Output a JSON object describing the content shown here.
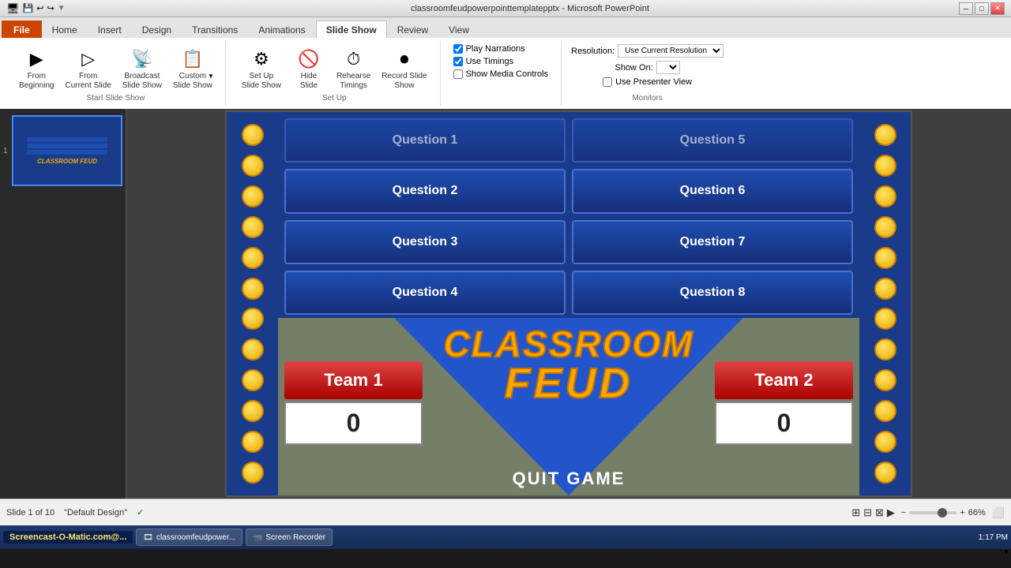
{
  "titlebar": {
    "title": "classroomfeudpowerpointtemplatepptx - Microsoft PowerPoint",
    "minimize": "─",
    "restore": "□",
    "close": "✕"
  },
  "ribbon": {
    "tabs": [
      "File",
      "Home",
      "Insert",
      "Design",
      "Transitions",
      "Animations",
      "Slide Show",
      "Review",
      "View"
    ],
    "active_tab": "Slide Show",
    "groups": {
      "start_slideshow": {
        "label": "Start Slide Show",
        "buttons": [
          {
            "label": "From Beginning",
            "icon": "▶"
          },
          {
            "label": "From Current Slide",
            "icon": "▷"
          },
          {
            "label": "Broadcast Slide Show",
            "icon": "📡"
          },
          {
            "label": "Custom Slide Show",
            "icon": "📋"
          }
        ]
      },
      "setup": {
        "label": "Set Up",
        "buttons": [
          {
            "label": "Set Up Slide Show",
            "icon": "⚙"
          },
          {
            "label": "Hide Slide",
            "icon": "🙈"
          },
          {
            "label": "Rehearse Timings",
            "icon": "⏱"
          },
          {
            "label": "Record Slide Show",
            "icon": "⏺"
          }
        ]
      },
      "monitors": {
        "label": "Monitors",
        "resolution_label": "Resolution:",
        "resolution_value": "Use Current Resolution",
        "show_on_label": "Show On:",
        "checkboxes": {
          "play_narrations": "Play Narrations",
          "use_timings": "Use Timings",
          "show_media_controls": "Show Media Controls",
          "use_presenter_view": "Use Presenter View"
        }
      }
    }
  },
  "questions": [
    {
      "label": "Question 2",
      "col": 0,
      "row": 1
    },
    {
      "label": "Question 3",
      "col": 0,
      "row": 2
    },
    {
      "label": "Question 4",
      "col": 0,
      "row": 3
    },
    {
      "label": "Question 6",
      "col": 1,
      "row": 1
    },
    {
      "label": "Question 7",
      "col": 1,
      "row": 2
    },
    {
      "label": "Question 8",
      "col": 1,
      "row": 3
    }
  ],
  "game": {
    "title_line1": "CLASSROOM",
    "title_line2": "FEUD",
    "team1_label": "Team 1",
    "team2_label": "Team 2",
    "team1_score": "0",
    "team2_score": "0",
    "quit_label": "QUIT GAME"
  },
  "statusbar": {
    "slide_info": "Slide 1 of 10",
    "theme": "\"Default Design\"",
    "spell_check": "✓",
    "zoom": "66%"
  },
  "taskbar": {
    "start_label": "Screencast-O-Matic.com@...",
    "items": [
      {
        "icon": "🎞",
        "label": "classroomfeudpower..."
      },
      {
        "icon": "📹",
        "label": "Screen Recorder"
      }
    ],
    "time": "1:17 PM"
  }
}
